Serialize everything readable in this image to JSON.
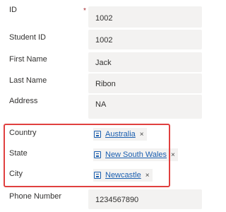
{
  "fields": {
    "id": {
      "label": "ID",
      "required_mark": "*",
      "value": "1002"
    },
    "student_id": {
      "label": "Student ID",
      "value": "1002"
    },
    "first_name": {
      "label": "First Name",
      "value": "Jack"
    },
    "last_name": {
      "label": "Last Name",
      "value": "Ribon"
    },
    "address": {
      "label": "Address",
      "value": "NA"
    },
    "country": {
      "label": "Country",
      "tag": "Australia",
      "remove": "×"
    },
    "state": {
      "label": "State",
      "tag": "New South Wales",
      "remove": "×"
    },
    "city": {
      "label": "City",
      "tag": "Newcastle",
      "remove": "×"
    },
    "phone": {
      "label": "Phone Number",
      "value": "1234567890"
    }
  },
  "colors": {
    "highlight_border": "#e0403f",
    "link": "#1b5fb0",
    "field_background": "#f3f2f1",
    "required": "#a4262c"
  }
}
